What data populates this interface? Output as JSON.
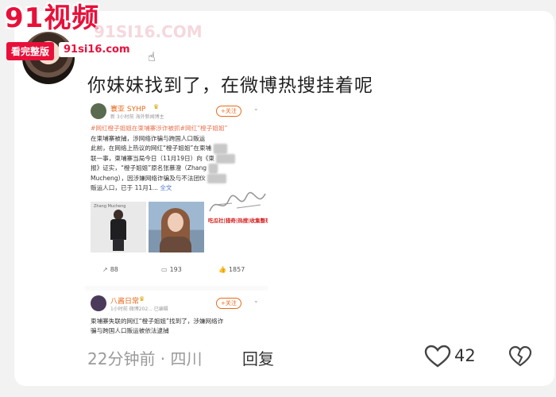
{
  "watermark": {
    "logo": "91视频",
    "ghost": "91SI16.COM",
    "badge": "看完整版",
    "url": "91si16.com"
  },
  "comment": {
    "text": "你妹妹找到了，在微博热搜挂着呢",
    "time_location": "22分钟前 · 四川",
    "reply_label": "回复",
    "likes": "42"
  },
  "screenshot": {
    "post1": {
      "user": "寰亚 SYHP",
      "meta": "新 3小时前  海外新闻博主",
      "follow": "+关注",
      "hashtags": "#网红橙子姐姐在柬埔寨涉诈被抓#网红“橙子姐姐”",
      "line2": "在柬埔寨被捕，涉网络诈骗与跨国人口贩运",
      "line3": "此前，在网络上热议的网红“橙子姐姐”在柬埔",
      "line4": "联一事，柬埔寨当局今日（11月19日）向《柬",
      "line5a": "报》证实，“橙子姐姐”原名张慕澄（Zhang",
      "line5b": "Mucheng），因涉嫌网络诈骗及与不法团伙",
      "line6": "贩运人口，已于 11月1...",
      "full_text": "全文",
      "image_caption": "Zhang Mucheng",
      "sig_text": "吃瓜社|猎奇|热搜|收集整理",
      "reposts": "88",
      "comments": "193",
      "likes": "1857"
    },
    "post2": {
      "user": "八酱日常",
      "meta": "1小时前  微博202...  已编辑",
      "follow": "+关注",
      "line1": "柬埔寨失联的网红“橙子姐姐”找到了，涉嫌网络诈",
      "line2": "骗与跨国人口贩运被依法逮捕"
    }
  },
  "icons": {
    "like": "heart-outline-icon",
    "dislike": "broken-heart-icon",
    "repost": "share-icon",
    "comment": "comment-icon",
    "thumb": "thumb-up-icon",
    "cursor": "hand-pointer-icon"
  },
  "colors": {
    "brand_red": "#e8103a",
    "weibo_orange": "#e86a1c",
    "link_blue": "#4a7bd0"
  }
}
